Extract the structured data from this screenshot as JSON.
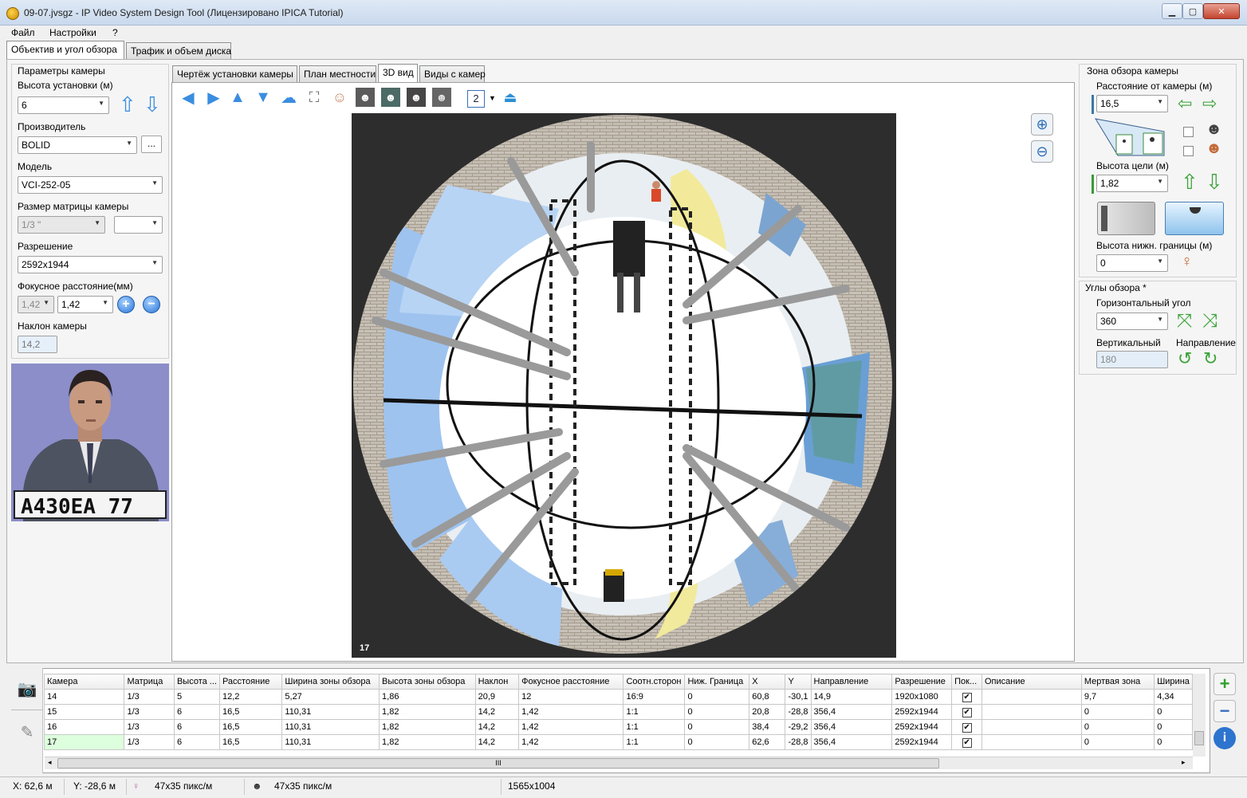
{
  "window": {
    "title": "09-07.jvsgz - IP Video System Design Tool (Лицензировано  IPICA Tutorial)"
  },
  "menu": [
    "Файл",
    "Настройки",
    "?"
  ],
  "top_tabs": [
    "Объектив и угол обзора",
    "Трафик и объем диска"
  ],
  "left": {
    "group_title": "Параметры камеры",
    "height_label": "Высота установки (м)",
    "height_value": "6",
    "manufacturer_label": "Производитель",
    "manufacturer_value": "BOLID",
    "browse_label": "...",
    "model_label": "Модель",
    "model_value": "VCI-252-05",
    "sensor_label": "Размер матрицы камеры",
    "sensor_value": "1/3 \"",
    "resolution_label": "Разрешение",
    "resolution_value": "2592x1944",
    "focal_label": "Фокусное расстояние(мм)",
    "focal_min": "1,42",
    "focal_value": "1,42",
    "tilt_label": "Наклон камеры",
    "tilt_value": "14,2",
    "plate_text": "А430ЕА 77"
  },
  "view_tabs": [
    "Чертёж установки камеры",
    "План местности",
    "3D вид",
    "Виды с камер"
  ],
  "toolbar": {
    "counter": "2"
  },
  "view3d": {
    "camera_label": "17"
  },
  "right": {
    "group1_title": "Зона обзора камеры",
    "distance_label": "Расстояние от камеры (м)",
    "distance_value": "16,5",
    "target_height_label": "Высота цели (м)",
    "target_height_value": "1,82",
    "lower_bound_label": "Высота нижн. границы (м)",
    "lower_bound_value": "0",
    "group2_title": "Углы обзора *",
    "hangle_label": "Горизонтальный угол",
    "hangle_value": "360",
    "vangle_label": "Вертикальный",
    "vangle_value": "180",
    "direction_label": "Направление"
  },
  "grid": {
    "columns": [
      "Камера",
      "Матрица",
      "Высота ...",
      "Расстояние",
      "Ширина зоны обзора",
      "Высота зоны обзора",
      "Наклон",
      "Фокусное расстояние",
      "Соотн.сторон",
      "Ниж. Граница",
      "X",
      "Y",
      "Направление",
      "Разрешение",
      "Пок...",
      "Описание",
      "Мертвая зона",
      "Ширина"
    ],
    "rows": [
      [
        "14",
        "1/3",
        "5",
        "12,2",
        "5,27",
        "1,86",
        "20,9",
        "12",
        "16:9",
        "0",
        "60,8",
        "-30,1",
        "14,9",
        "1920x1080",
        "✔",
        "",
        "9,7",
        "4,34"
      ],
      [
        "15",
        "1/3",
        "6",
        "16,5",
        "110,31",
        "1,82",
        "14,2",
        "1,42",
        "1:1",
        "0",
        "20,8",
        "-28,8",
        "356,4",
        "2592x1944",
        "✔",
        "",
        "0",
        "0"
      ],
      [
        "16",
        "1/3",
        "6",
        "16,5",
        "110,31",
        "1,82",
        "14,2",
        "1,42",
        "1:1",
        "0",
        "38,4",
        "-29,2",
        "356,4",
        "2592x1944",
        "✔",
        "",
        "0",
        "0"
      ],
      [
        "17",
        "1/3",
        "6",
        "16,5",
        "110,31",
        "1,82",
        "14,2",
        "1,42",
        "1:1",
        "0",
        "62,6",
        "-28,8",
        "356,4",
        "2592x1944",
        "✔",
        "",
        "0",
        "0"
      ]
    ],
    "hscroll_grip": "III"
  },
  "status": {
    "x": "X: 62,6 м",
    "y": "Y: -28,6 м",
    "pix1": "47x35 пикс/м",
    "pix2": "47x35 пикс/м",
    "size": "1565x1004"
  },
  "colors": {
    "accent": "#3a8de0",
    "selected_row": "#ddffdd",
    "titlebar": "#c9d9ee"
  }
}
